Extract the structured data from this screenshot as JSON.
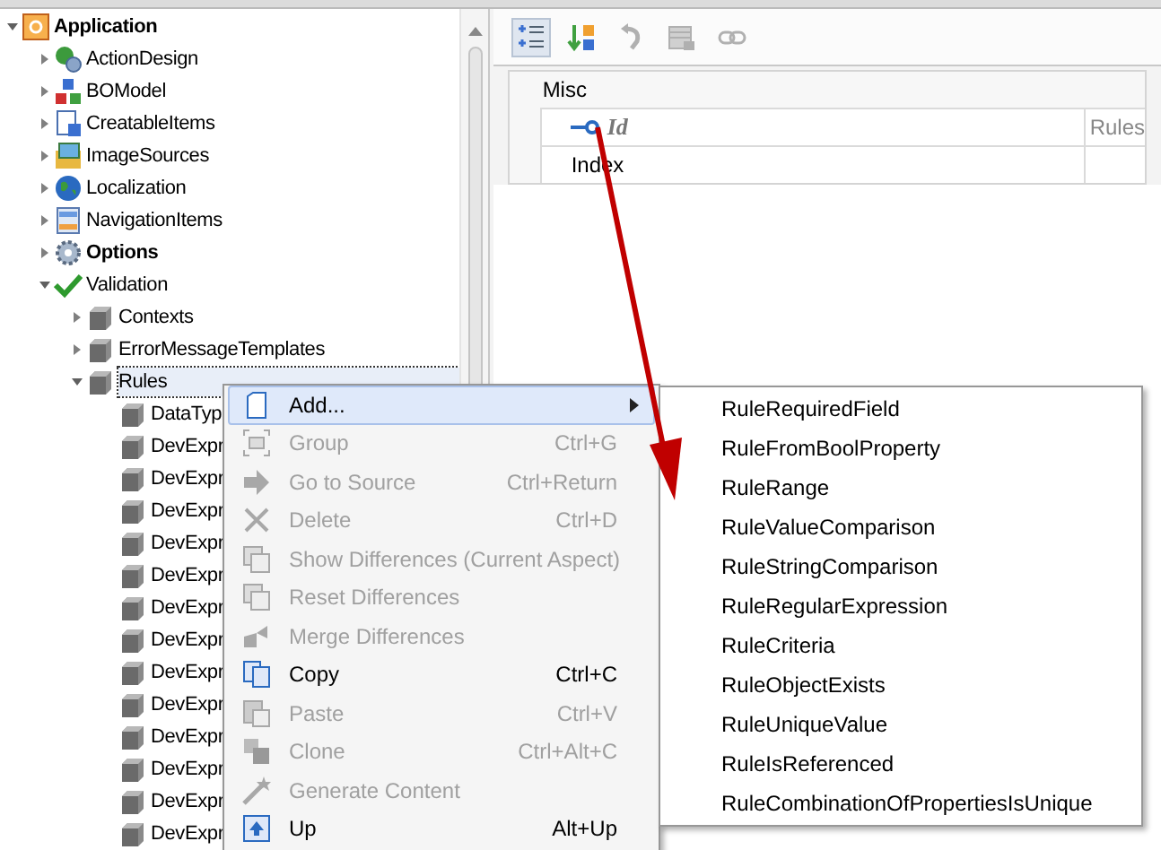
{
  "tree": [
    {
      "label": "Application",
      "kind": "app",
      "bold": true,
      "expanded": true,
      "selected": false,
      "children": [
        {
          "label": "ActionDesign",
          "kind": "action",
          "bold": false,
          "expanded": false,
          "selected": false
        },
        {
          "label": "BOModel",
          "kind": "model",
          "bold": false,
          "expanded": false,
          "selected": false
        },
        {
          "label": "CreatableItems",
          "kind": "doc",
          "bold": false,
          "expanded": false,
          "selected": false
        },
        {
          "label": "ImageSources",
          "kind": "image",
          "bold": false,
          "expanded": false,
          "selected": false
        },
        {
          "label": "Localization",
          "kind": "globe",
          "bold": false,
          "expanded": false,
          "selected": false
        },
        {
          "label": "NavigationItems",
          "kind": "nav",
          "bold": false,
          "expanded": false,
          "selected": false
        },
        {
          "label": "Options",
          "kind": "gear",
          "bold": true,
          "expanded": false,
          "selected": false
        },
        {
          "label": "Validation",
          "kind": "check",
          "bold": false,
          "expanded": true,
          "selected": false,
          "children": [
            {
              "label": "Contexts",
              "kind": "cube",
              "bold": false,
              "expanded": false,
              "selected": false
            },
            {
              "label": "ErrorMessageTemplates",
              "kind": "cube",
              "bold": false,
              "expanded": false,
              "selected": false
            },
            {
              "label": "Rules",
              "kind": "cube",
              "bold": false,
              "expanded": true,
              "selected": true,
              "children": [
                {
                  "label": "DataTyp",
                  "kind": "cube",
                  "bold": false,
                  "selected": false
                },
                {
                  "label": "DevExpr",
                  "kind": "cube",
                  "bold": false,
                  "selected": false
                },
                {
                  "label": "DevExpr",
                  "kind": "cube",
                  "bold": false,
                  "selected": false
                },
                {
                  "label": "DevExpr",
                  "kind": "cube",
                  "bold": false,
                  "selected": false
                },
                {
                  "label": "DevExpr",
                  "kind": "cube",
                  "bold": false,
                  "selected": false
                },
                {
                  "label": "DevExpr",
                  "kind": "cube",
                  "bold": false,
                  "selected": false
                },
                {
                  "label": "DevExpr",
                  "kind": "cube",
                  "bold": false,
                  "selected": false
                },
                {
                  "label": "DevExpr",
                  "kind": "cube",
                  "bold": false,
                  "selected": false
                },
                {
                  "label": "DevExpr",
                  "kind": "cube",
                  "bold": false,
                  "selected": false
                },
                {
                  "label": "DevExpr",
                  "kind": "cube",
                  "bold": false,
                  "selected": false
                },
                {
                  "label": "DevExpr",
                  "kind": "cube",
                  "bold": false,
                  "selected": false
                },
                {
                  "label": "DevExpr",
                  "kind": "cube",
                  "bold": false,
                  "selected": false
                },
                {
                  "label": "DevExpr",
                  "kind": "cube",
                  "bold": false,
                  "selected": false
                },
                {
                  "label": "DevExpr",
                  "kind": "cube",
                  "bold": false,
                  "selected": false
                }
              ]
            }
          ]
        }
      ]
    }
  ],
  "toolbar": [
    {
      "kind": "categorized",
      "selected": true,
      "disabled": false
    },
    {
      "kind": "alphabetical",
      "selected": false,
      "disabled": false
    },
    {
      "kind": "undo",
      "selected": false,
      "disabled": true
    },
    {
      "kind": "table",
      "selected": false,
      "disabled": true
    },
    {
      "kind": "link",
      "selected": false,
      "disabled": true
    }
  ],
  "property_grid": {
    "category": "Misc",
    "rows": [
      {
        "name": "Id",
        "key": true,
        "value": "Rules"
      },
      {
        "name": "Index",
        "key": false,
        "value": ""
      }
    ]
  },
  "context_menu": [
    {
      "label": "Add...",
      "kind": "page",
      "disabled": false,
      "submenu": true,
      "selected": true
    },
    {
      "label": "Group",
      "shortcut": "Ctrl+G",
      "kind": "group",
      "disabled": true,
      "submenu": false,
      "selected": false
    },
    {
      "label": "Go to Source",
      "shortcut": "Ctrl+Return",
      "kind": "arrow",
      "disabled": true,
      "submenu": false,
      "selected": false
    },
    {
      "label": "Delete",
      "shortcut": "Ctrl+D",
      "kind": "delete",
      "disabled": true,
      "submenu": false,
      "selected": false
    },
    {
      "label": "Show Differences (Current Aspect)",
      "kind": "xml",
      "disabled": true,
      "submenu": false,
      "selected": false
    },
    {
      "label": "Reset Differences",
      "kind": "xml",
      "disabled": true,
      "submenu": false,
      "selected": false
    },
    {
      "label": "Merge Differences",
      "kind": "merge",
      "disabled": true,
      "submenu": false,
      "selected": false
    },
    {
      "label": "Copy",
      "shortcut": "Ctrl+C",
      "kind": "copy",
      "disabled": false,
      "submenu": false,
      "selected": false
    },
    {
      "label": "Paste",
      "shortcut": "Ctrl+V",
      "kind": "paste",
      "disabled": true,
      "submenu": false,
      "selected": false
    },
    {
      "label": "Clone",
      "shortcut": "Ctrl+Alt+C",
      "kind": "clone",
      "disabled": true,
      "submenu": false,
      "selected": false
    },
    {
      "label": "Generate Content",
      "kind": "wand",
      "disabled": true,
      "submenu": false,
      "selected": false
    },
    {
      "label": "Up",
      "shortcut": "Alt+Up",
      "kind": "up",
      "disabled": false,
      "submenu": false,
      "selected": false
    }
  ],
  "submenu": [
    "RuleRequiredField",
    "RuleFromBoolProperty",
    "RuleRange",
    "RuleValueComparison",
    "RuleStringComparison",
    "RuleRegularExpression",
    "RuleCriteria",
    "RuleObjectExists",
    "RuleUniqueValue",
    "RuleIsReferenced",
    "RuleCombinationOfPropertiesIsUnique"
  ]
}
